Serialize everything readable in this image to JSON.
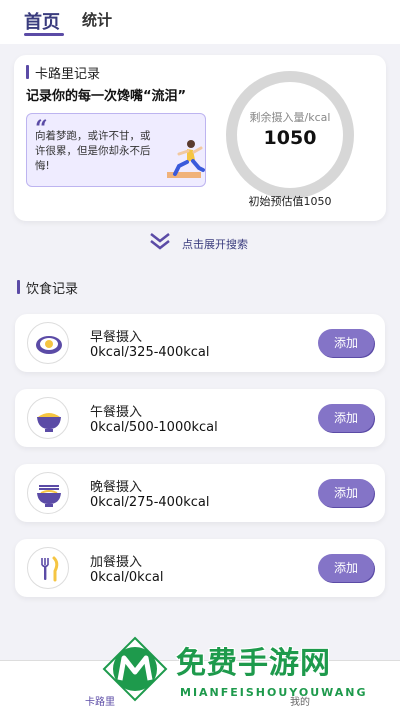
{
  "tabs": [
    {
      "label": "首页",
      "active": true
    },
    {
      "label": "统计",
      "active": false
    }
  ],
  "calorie_card": {
    "title": "卡路里记录",
    "subtitle": "记录你的每一次馋嘴“流泪”",
    "quote": "向着梦跑，或许不甘，或许很累，但是你却永不后悔!",
    "remaining_label": "剩余摄入量/kcal",
    "remaining_value": "1050",
    "initial_estimate": "初始预估值1050"
  },
  "expand_search": {
    "label": "点击展开搜索",
    "icon": "double-chevron-down-icon"
  },
  "meal_section": {
    "title": "饮食记录"
  },
  "meals": [
    {
      "name": "早餐摄入",
      "kcal": "0kcal/325-400kcal",
      "button": "添加",
      "icon": "fried-egg-icon"
    },
    {
      "name": "午餐摄入",
      "kcal": "0kcal/500-1000kcal",
      "button": "添加",
      "icon": "rice-bowl-icon"
    },
    {
      "name": "晚餐摄入",
      "kcal": "0kcal/275-400kcal",
      "button": "添加",
      "icon": "noodle-bowl-icon"
    },
    {
      "name": "加餐摄入",
      "kcal": "0kcal/0kcal",
      "button": "添加",
      "icon": "fork-knife-icon"
    }
  ],
  "bottom_nav": [
    {
      "label": "卡路里"
    },
    {
      "label": "我的"
    }
  ],
  "watermark": {
    "title": "免费手游网",
    "subtitle": "MIANFEISHOUYOUWANG"
  },
  "colors": {
    "accent": "#5b4ba6",
    "button": "#8474c7",
    "watermark": "#1e9a4c"
  }
}
